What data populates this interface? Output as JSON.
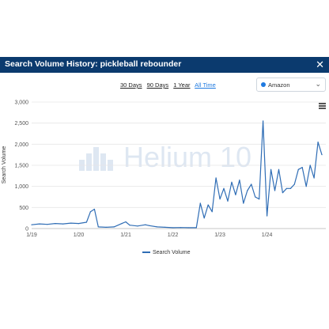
{
  "header": {
    "title": "Search Volume History: pickleball rebounder",
    "close_icon": "close-icon"
  },
  "ranges": {
    "items": [
      "30 Days",
      "90 Days",
      "1 Year",
      "All Time"
    ],
    "active": "All Time"
  },
  "marketplace": {
    "selected": "Amazon",
    "dot_color": "#1f7ae0"
  },
  "watermark": {
    "text": "Helium 10"
  },
  "chart_data": {
    "type": "line",
    "title": "",
    "xlabel": "",
    "ylabel": "Search Volume",
    "ylim": [
      0,
      3000
    ],
    "yticks": [
      "0",
      "500",
      "1,000",
      "1,500",
      "2,000",
      "2,500",
      "3,000"
    ],
    "xticks": [
      "1/19",
      "1/20",
      "1/21",
      "1/22",
      "1/23",
      "1/24"
    ],
    "series": [
      {
        "name": "Search Volume",
        "color": "#2f6db5",
        "points": [
          [
            "2019-01",
            90
          ],
          [
            "2019-03",
            110
          ],
          [
            "2019-05",
            100
          ],
          [
            "2019-07",
            120
          ],
          [
            "2019-09",
            110
          ],
          [
            "2019-11",
            130
          ],
          [
            "2020-01",
            120
          ],
          [
            "2020-03",
            150
          ],
          [
            "2020-04",
            400
          ],
          [
            "2020-05",
            460
          ],
          [
            "2020-06",
            40
          ],
          [
            "2020-08",
            30
          ],
          [
            "2020-10",
            40
          ],
          [
            "2020-12",
            120
          ],
          [
            "2021-01",
            160
          ],
          [
            "2021-02",
            80
          ],
          [
            "2021-04",
            60
          ],
          [
            "2021-06",
            90
          ],
          [
            "2021-07",
            70
          ],
          [
            "2021-09",
            40
          ],
          [
            "2021-11",
            30
          ],
          [
            "2022-01",
            20
          ],
          [
            "2022-03",
            25
          ],
          [
            "2022-05",
            20
          ],
          [
            "2022-07",
            20
          ],
          [
            "2022-08",
            600
          ],
          [
            "2022-09",
            250
          ],
          [
            "2022-10",
            560
          ],
          [
            "2022-11",
            400
          ],
          [
            "2022-12",
            1200
          ],
          [
            "2023-01",
            700
          ],
          [
            "2023-02",
            950
          ],
          [
            "2023-03",
            650
          ],
          [
            "2023-04",
            1100
          ],
          [
            "2023-05",
            800
          ],
          [
            "2023-06",
            1150
          ],
          [
            "2023-07",
            600
          ],
          [
            "2023-08",
            900
          ],
          [
            "2023-09",
            1050
          ],
          [
            "2023-10",
            750
          ],
          [
            "2023-11",
            700
          ],
          [
            "2023-12",
            2550
          ],
          [
            "2024-01",
            300
          ],
          [
            "2024-02",
            1400
          ],
          [
            "2024-03",
            900
          ],
          [
            "2024-04",
            1400
          ],
          [
            "2024-05",
            850
          ],
          [
            "2024-06",
            950
          ],
          [
            "2024-07",
            950
          ],
          [
            "2024-08",
            1050
          ],
          [
            "2024-09",
            1400
          ],
          [
            "2024-10",
            1450
          ],
          [
            "2024-11",
            1000
          ],
          [
            "2024-12",
            1500
          ],
          [
            "2025-01",
            1200
          ],
          [
            "2025-02",
            2050
          ],
          [
            "2025-03",
            1750
          ]
        ]
      }
    ],
    "legend": "bottom",
    "grid": true
  }
}
